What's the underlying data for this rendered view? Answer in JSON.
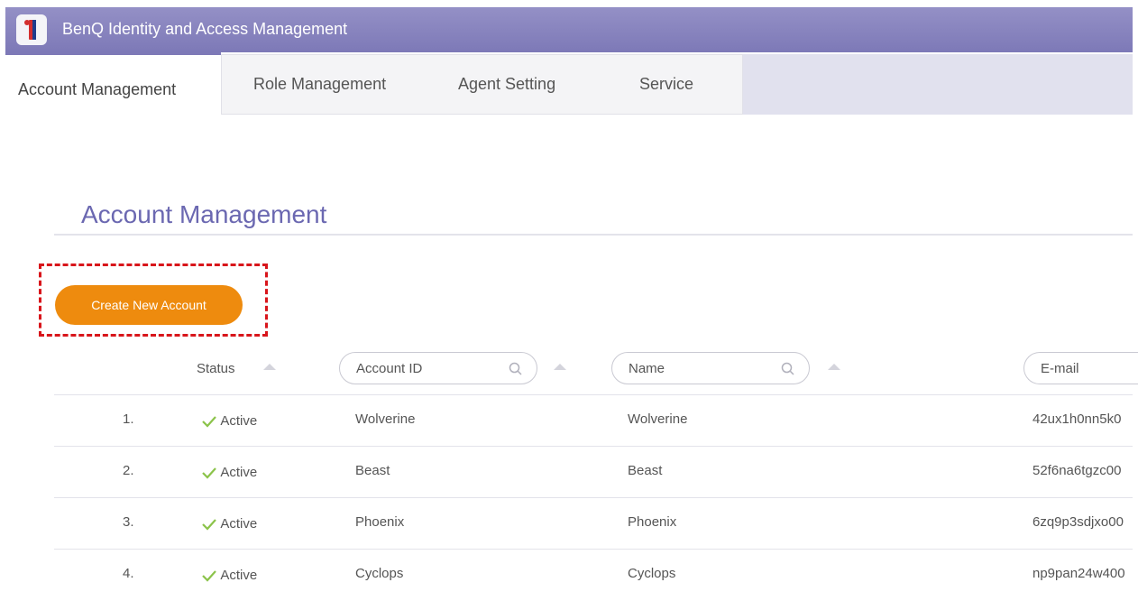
{
  "app": {
    "title": "BenQ Identity and Access Management"
  },
  "tabs": {
    "active": "Account Management",
    "items": [
      "Role Management",
      "Agent Setting",
      "Service"
    ]
  },
  "page": {
    "title": "Account Management",
    "create_button": "Create New Account"
  },
  "table": {
    "columns": {
      "status": "Status",
      "account_id": "Account ID",
      "name": "Name",
      "email": "E-mail"
    },
    "rows": [
      {
        "index": "1.",
        "status": "Active",
        "account_id": "Wolverine",
        "name": "Wolverine",
        "email": "42ux1h0nn5k0"
      },
      {
        "index": "2.",
        "status": "Active",
        "account_id": "Beast",
        "name": "Beast",
        "email": "52f6na6tgzc00"
      },
      {
        "index": "3.",
        "status": "Active",
        "account_id": "Phoenix",
        "name": "Phoenix",
        "email": "6zq9p3sdjxo00"
      },
      {
        "index": "4.",
        "status": "Active",
        "account_id": "Cyclops",
        "name": "Cyclops",
        "email": "np9pan24w400"
      }
    ]
  },
  "colors": {
    "header": "#8a86bf",
    "accent_title": "#6b68b1",
    "button": "#ee8b0e",
    "highlight": "#d8151b",
    "active_check": "#8bc34a"
  },
  "icons": {
    "logo": "benq-iam-logo-icon",
    "search": "search-icon",
    "sort": "sort-up-icon",
    "status": "check-icon"
  }
}
